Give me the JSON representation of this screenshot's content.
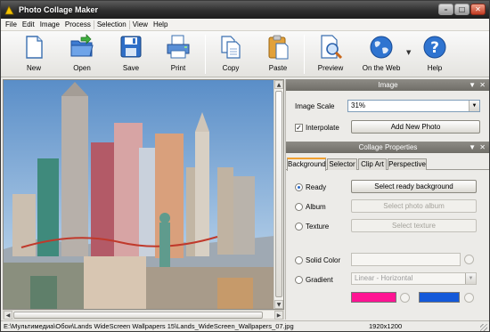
{
  "window": {
    "title": "Photo Collage Maker"
  },
  "menu": [
    "File",
    "Edit",
    "Image",
    "Process",
    "Selection",
    "View",
    "Help"
  ],
  "toolbar": {
    "new": "New",
    "open": "Open",
    "save": "Save",
    "print": "Print",
    "copy": "Copy",
    "paste": "Paste",
    "preview": "Preview",
    "on_the_web": "On the Web",
    "help": "Help"
  },
  "image_panel": {
    "header": "Image",
    "scale_label": "Image Scale",
    "scale_value": "31%",
    "interpolate_label": "Interpolate",
    "interpolate_checked": true,
    "add_photo_button": "Add New Photo"
  },
  "collage_panel": {
    "header": "Collage Properties",
    "tabs": [
      "Background",
      "Selector",
      "Clip Art",
      "Perspective"
    ],
    "active_tab": "Background",
    "options": {
      "ready_label": "Ready",
      "ready_button": "Select ready background",
      "album_label": "Album",
      "album_button": "Select photo album",
      "texture_label": "Texture",
      "texture_button": "Select texture",
      "solid_label": "Solid Color",
      "gradient_label": "Gradient",
      "gradient_type": "Linear - Horizontal"
    },
    "selected_option": "Ready",
    "gradient_colors": {
      "start": "#ff1493",
      "end": "#1459d9"
    }
  },
  "statusbar": {
    "path": "E:\\Мультимедиа\\Обои\\Lands WideScreen Wallpapers 15\\Lands_WideScreen_Wallpapers_07.jpg",
    "resolution": "1920x1200"
  }
}
